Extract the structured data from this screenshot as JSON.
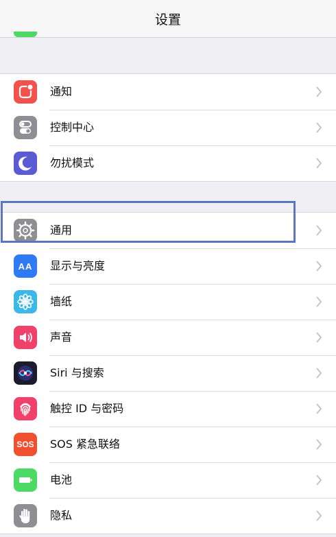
{
  "nav": {
    "title": "设置"
  },
  "groups": [
    {
      "items": [
        {
          "label": "通知",
          "icon": "notifications-icon",
          "color": "#f2524b"
        },
        {
          "label": "控制中心",
          "icon": "control-center-icon",
          "color": "#8e8e93"
        },
        {
          "label": "勿扰模式",
          "icon": "moon-icon",
          "color": "#5b5bd6"
        }
      ]
    },
    {
      "items": [
        {
          "label": "通用",
          "icon": "gear-icon",
          "color": "#8e8e93"
        },
        {
          "label": "显示与亮度",
          "icon": "display-brightness-icon",
          "color": "#2f7bf6"
        },
        {
          "label": "墙纸",
          "icon": "wallpaper-flower-icon",
          "color": "#3bb8e8"
        },
        {
          "label": "声音",
          "icon": "speaker-icon",
          "color": "#f0416a"
        },
        {
          "label": "Siri 与搜索",
          "icon": "siri-icon",
          "color": "#1c1c2e"
        },
        {
          "label": "触控 ID 与密码",
          "icon": "fingerprint-icon",
          "color": "#f0416a"
        },
        {
          "label": "SOS 紧急联络",
          "icon": "sos-icon",
          "color": "#f0502d",
          "icon_text": "SOS"
        },
        {
          "label": "电池",
          "icon": "battery-icon",
          "color": "#4cd964"
        },
        {
          "label": "隐私",
          "icon": "hand-icon",
          "color": "#8e8e93"
        }
      ]
    }
  ],
  "icon_text": {
    "display": "AA"
  },
  "highlight_color": "#5b74c4"
}
